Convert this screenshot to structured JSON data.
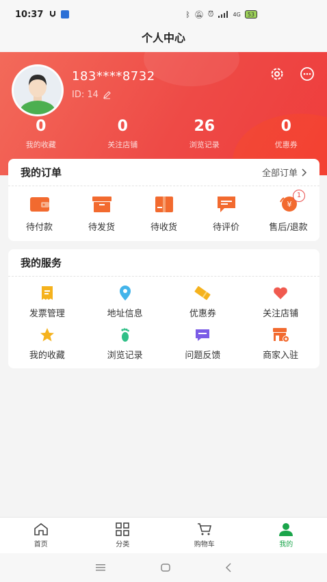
{
  "status": {
    "time": "10:37",
    "network_label": "4G",
    "battery": "53"
  },
  "header": {
    "title": "个人中心"
  },
  "profile": {
    "phone": "183****8732",
    "id_label": "ID: 14"
  },
  "stats": [
    {
      "value": "0",
      "label": "我的收藏"
    },
    {
      "value": "0",
      "label": "关注店铺"
    },
    {
      "value": "26",
      "label": "浏览记录"
    },
    {
      "value": "0",
      "label": "优惠券"
    }
  ],
  "orders": {
    "title": "我的订单",
    "all_label": "全部订单",
    "items": [
      {
        "label": "待付款",
        "icon": "wallet-icon"
      },
      {
        "label": "待发货",
        "icon": "box-icon"
      },
      {
        "label": "待收货",
        "icon": "package-icon"
      },
      {
        "label": "待评价",
        "icon": "comment-icon"
      },
      {
        "label": "售后/退款",
        "icon": "refund-icon",
        "badge": "1"
      }
    ]
  },
  "services": {
    "title": "我的服务",
    "items": [
      {
        "label": "发票管理",
        "icon": "invoice-icon"
      },
      {
        "label": "地址信息",
        "icon": "location-icon"
      },
      {
        "label": "优惠券",
        "icon": "coupon-icon"
      },
      {
        "label": "关注店铺",
        "icon": "heart-icon"
      },
      {
        "label": "我的收藏",
        "icon": "star-icon"
      },
      {
        "label": "浏览记录",
        "icon": "footprint-icon"
      },
      {
        "label": "问题反馈",
        "icon": "feedback-icon"
      },
      {
        "label": "商家入驻",
        "icon": "store-icon"
      }
    ]
  },
  "tabbar": [
    {
      "label": "首页",
      "icon": "home-icon"
    },
    {
      "label": "分类",
      "icon": "grid-icon"
    },
    {
      "label": "购物车",
      "icon": "cart-icon"
    },
    {
      "label": "我的",
      "icon": "user-icon",
      "active": true
    }
  ],
  "colors": {
    "brand_red": "#ee4a46",
    "orange": "#f08a24",
    "active_green": "#1aa54a"
  }
}
